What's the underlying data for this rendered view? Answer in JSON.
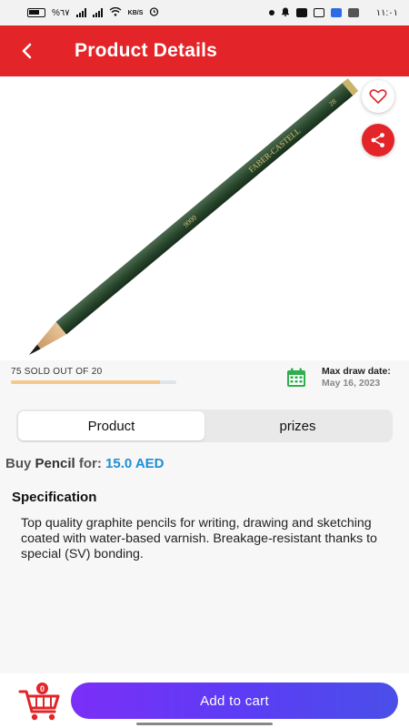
{
  "status_bar": {
    "battery": "%٦٧",
    "network_speed": "KB/S",
    "time": "١١:٠١"
  },
  "header": {
    "title": "Product Details",
    "back_icon": "arrow-back-icon"
  },
  "product_image": {
    "brand_text": "FABER-CASTELL",
    "model_text": "9000",
    "grade_text": "2B"
  },
  "actions": {
    "favorite_icon": "heart-outline-icon",
    "share_icon": "share-icon"
  },
  "progress": {
    "text": "75 SOLD OUT OF 20",
    "fill_fraction": 0.9
  },
  "draw": {
    "label": "Max draw date:",
    "date": "May 16, 2023"
  },
  "tabs": [
    {
      "label": "Product",
      "active": true
    },
    {
      "label": "prizes",
      "active": false
    }
  ],
  "buy": {
    "prefix": "Buy ",
    "product": "Pencil",
    "middle": " for: ",
    "price": "15.0 AED"
  },
  "specification": {
    "title": "Specification",
    "body": "Top quality graphite pencils for writing, drawing and sketching coated with water-based varnish. Breakage-resistant thanks to special (SV) bonding."
  },
  "bottom": {
    "cart_count": "0",
    "add_to_cart": "Add to cart"
  },
  "colors": {
    "primary_red": "#e32428",
    "price_blue": "#1d8ed6",
    "button_gradient_start": "#7b2ff7",
    "button_gradient_end": "#4a4fe8",
    "calendar_green": "#2eae4e"
  }
}
